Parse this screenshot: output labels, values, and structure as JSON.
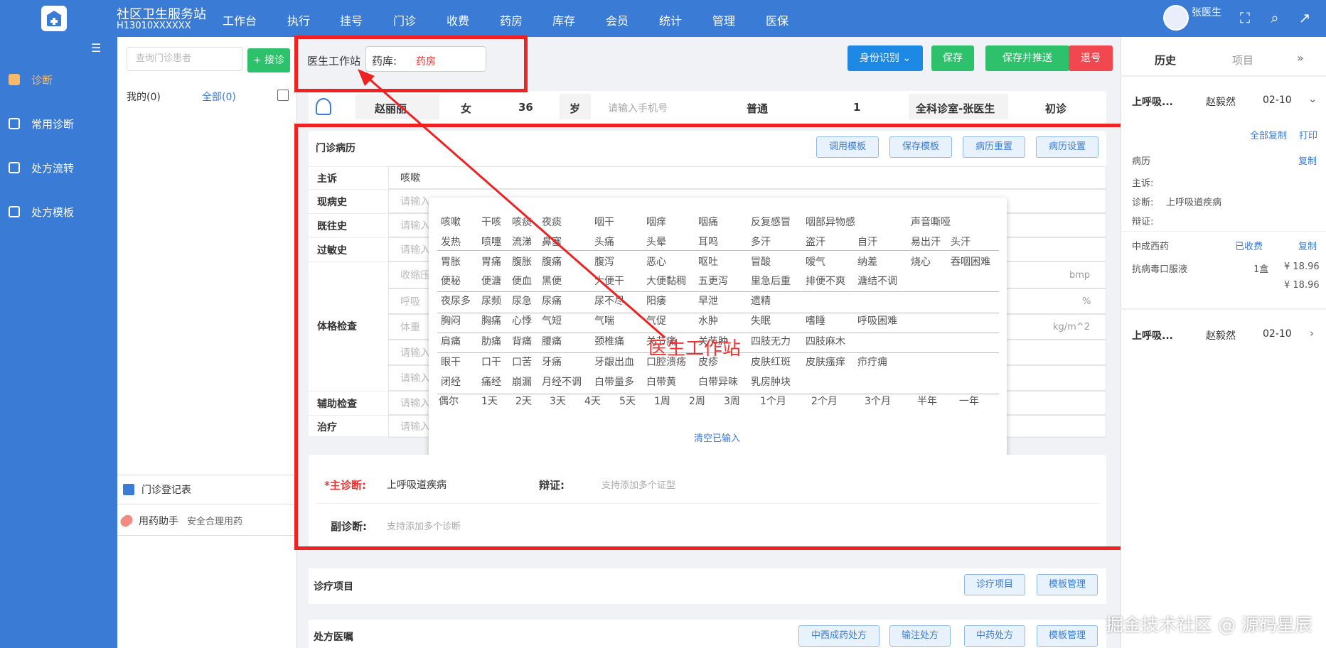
{
  "app": {
    "station": "社区卫生服务站",
    "code": "H13010XXXXXX",
    "user": "张医生"
  },
  "nav": [
    "工作台",
    "执行",
    "挂号",
    "门诊",
    "收费",
    "药房",
    "库存",
    "会员",
    "统计",
    "管理",
    "医保"
  ],
  "sidebar": [
    "诊断",
    "常用诊断",
    "处方流转",
    "处方模板"
  ],
  "patients": {
    "search_placeholder": "查询门诊患者",
    "receive": "+ 接诊",
    "mine": "我的(0)",
    "all": "全部(0)",
    "register": "门诊登记表",
    "med_assist": "用药助手",
    "med_assist_sub": "安全合理用药"
  },
  "toolbar": {
    "workstation": "医生工作站",
    "pharmacy_label": "药库:",
    "pharmacy_value": "药房",
    "id": "身份识别 ⌄",
    "save": "保存",
    "save_push": "保存并推送",
    "refund": "退号"
  },
  "patient": {
    "name": "赵丽丽",
    "sex": "女",
    "age": "36",
    "age_unit": "岁",
    "phone_placeholder": "请输入手机号",
    "type": "普通",
    "num": "1",
    "dept": "全科诊室-张医生",
    "visit": "初诊"
  },
  "record": {
    "title": "门诊病历",
    "buttons": [
      "调用模板",
      "保存模板",
      "病历重置",
      "病历设置"
    ],
    "rows": {
      "complaint": "主诉",
      "complaint_val": "咳嗽",
      "present": "现病史",
      "past": "既往史",
      "allergy": "过敏史",
      "exam": "体格检查",
      "aux": "辅助检查",
      "treat": "治疗"
    },
    "placeholder": "请输入",
    "exam_bp": "收缩压",
    "exam_resp": "呼吸",
    "exam_weight": "体重",
    "unit_bmp": "bmp",
    "unit_pct": "%",
    "unit_bmi": "kg/m^2"
  },
  "symptoms": [
    [
      "咳嗽",
      "干咳",
      "咳痰",
      "夜痰",
      "咽干",
      "咽痒",
      "咽痛",
      "反复感冒",
      "咽部异物感",
      "",
      "声音嘶哑"
    ],
    [
      "发热",
      "喷嚏",
      "流涕",
      "鼻塞",
      "头痛",
      "头晕",
      "耳鸣",
      "多汗",
      "盗汗",
      "自汗",
      "易出汗",
      "头汗"
    ],
    [
      "胃胀",
      "胃痛",
      "腹胀",
      "腹痛",
      "腹泻",
      "恶心",
      "呕吐",
      "冒酸",
      "嗳气",
      "纳差",
      "烧心",
      "吞咽困难"
    ],
    [
      "便秘",
      "便溏",
      "便血",
      "黑便",
      "大便干",
      "大便黏稠",
      "五更泻",
      "里急后重",
      "排便不爽",
      "溏结不调"
    ],
    [
      "夜尿多",
      "尿频",
      "尿急",
      "尿痛",
      "尿不尽",
      "阳痿",
      "早泄",
      "遗精"
    ],
    [
      "胸闷",
      "胸痛",
      "心悸",
      "气短",
      "气喘",
      "气促",
      "水肿",
      "失眠",
      "嗜睡",
      "呼吸困难"
    ],
    [
      "肩痛",
      "肋痛",
      "背痛",
      "腰痛",
      "颈椎痛",
      "关节痛",
      "关节肿",
      "四肢无力",
      "四肢麻木"
    ],
    [
      "眼干",
      "口干",
      "口苦",
      "牙痛",
      "牙龈出血",
      "口腔溃疡",
      "皮疹",
      "皮肤红斑",
      "皮肤瘙痒",
      "疖疔痈"
    ],
    [
      "闭经",
      "痛经",
      "崩漏",
      "月经不调",
      "白带量多",
      "白带黄",
      "白带异味",
      "乳房肿块"
    ],
    [
      "偶尔",
      "1天",
      "2天",
      "3天",
      "4天",
      "5天",
      "1周",
      "2周",
      "3周",
      "1个月",
      "2个月",
      "3个月",
      "半年",
      "一年"
    ]
  ],
  "clear_input": "清空已输入",
  "annotation": "医生工作站",
  "diagnosis": {
    "main_label": "*主诊断:",
    "main_val": "上呼吸道疾病",
    "syndrome_label": "辩证:",
    "syndrome_ph": "支持添加多个证型",
    "sub_label": "副诊断:",
    "sub_ph": "支持添加多个诊断"
  },
  "items": {
    "title": "诊疗项目",
    "btn1": "诊疗项目",
    "btn2": "模板管理"
  },
  "rx": {
    "title": "处方医嘱",
    "btns": [
      "中西成药处方",
      "输注处方",
      "中药处方",
      "模板管理"
    ]
  },
  "history": {
    "tabs": [
      "历史",
      "项目"
    ],
    "rec1": {
      "diag": "上呼吸...",
      "doctor": "赵毅然",
      "date": "02-10"
    },
    "copy_all": "全部复制",
    "print": "打印",
    "record": "病历",
    "copy": "复制",
    "complaint": "主诉:",
    "diagnosis": "诊断:",
    "diag_val": "上呼吸道疾病",
    "syndrome": "辩证:",
    "med_title": "中成西药",
    "paid": "已收费",
    "med": "抗病毒口服液",
    "qty": "1盒",
    "price": "¥ 18.96",
    "total": "¥ 18.96",
    "rec2": {
      "diag": "上呼吸...",
      "doctor": "赵毅然",
      "date": "02-10"
    }
  },
  "watermark": "掘金技术社区 @ 源码星辰"
}
